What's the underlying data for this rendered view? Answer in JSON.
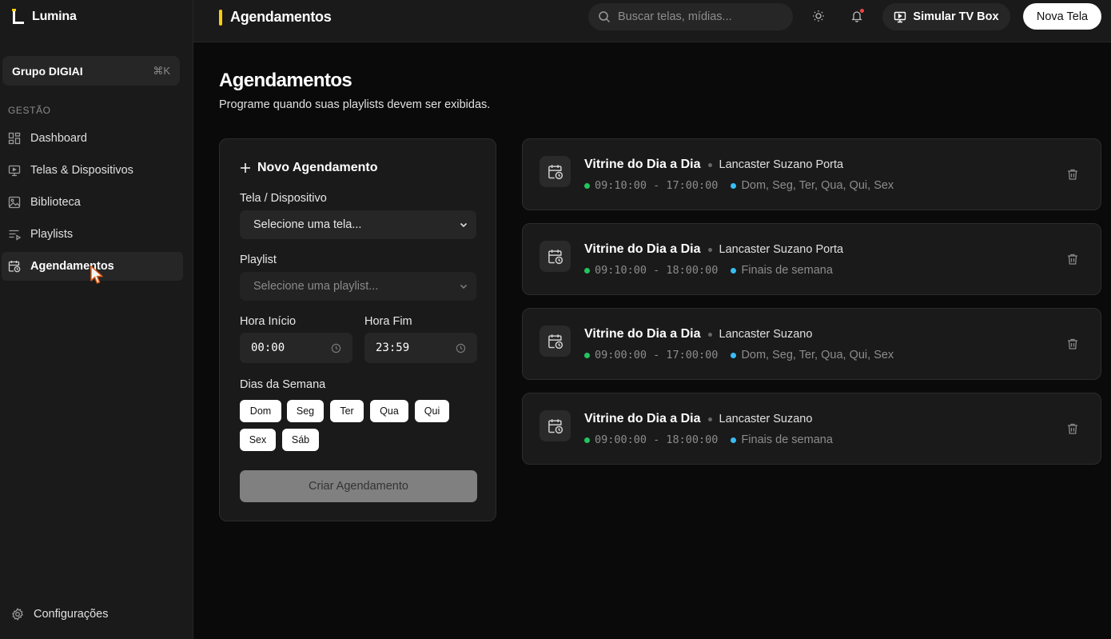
{
  "brand": {
    "name": "Lumina",
    "accent": "#facc15"
  },
  "org": {
    "name": "Grupo DIGIAI",
    "shortcut": "⌘K"
  },
  "sidebar": {
    "section": "GESTÃO",
    "items": [
      {
        "label": "Dashboard",
        "icon": "dashboard-icon",
        "active": false
      },
      {
        "label": "Telas & Dispositivos",
        "icon": "monitor-icon",
        "active": false
      },
      {
        "label": "Biblioteca",
        "icon": "image-icon",
        "active": false
      },
      {
        "label": "Playlists",
        "icon": "playlist-icon",
        "active": false
      },
      {
        "label": "Agendamentos",
        "icon": "calendar-clock-icon",
        "active": true
      }
    ],
    "settings_label": "Configurações"
  },
  "topbar": {
    "title": "Agendamentos",
    "search_placeholder": "Buscar telas, mídias...",
    "tvbox_label": "Simular TV Box",
    "new_screen_label": "Nova Tela"
  },
  "page": {
    "title": "Agendamentos",
    "subtitle": "Programe quando suas playlists devem ser exibidas."
  },
  "form": {
    "heading": "Novo Agendamento",
    "screen_label": "Tela / Dispositivo",
    "screen_value": "Selecione uma tela...",
    "playlist_label": "Playlist",
    "playlist_value": "Selecione uma playlist...",
    "start_label": "Hora Início",
    "start_value": "00:00",
    "end_label": "Hora Fim",
    "end_value": "23:59",
    "days_label": "Dias da Semana",
    "days": [
      "Dom",
      "Seg",
      "Ter",
      "Qua",
      "Qui",
      "Sex",
      "Sáb"
    ],
    "submit_label": "Criar Agendamento"
  },
  "schedules": [
    {
      "playlist": "Vitrine do Dia a Dia",
      "screen": "Lancaster Suzano Porta",
      "time": "09:10:00 - 17:00:00",
      "days": "Dom, Seg, Ter, Qua, Qui, Sex"
    },
    {
      "playlist": "Vitrine do Dia a Dia",
      "screen": "Lancaster Suzano Porta",
      "time": "09:10:00 - 18:00:00",
      "days": "Finais de semana"
    },
    {
      "playlist": "Vitrine do Dia a Dia",
      "screen": "Lancaster Suzano",
      "time": "09:00:00 - 17:00:00",
      "days": "Dom, Seg, Ter, Qua, Qui, Sex"
    },
    {
      "playlist": "Vitrine do Dia a Dia",
      "screen": "Lancaster Suzano",
      "time": "09:00:00 - 18:00:00",
      "days": "Finais de semana"
    }
  ],
  "colors": {
    "active_dot": "#22c55e",
    "days_dot": "#38bdf8",
    "notification": "#ef4444"
  }
}
